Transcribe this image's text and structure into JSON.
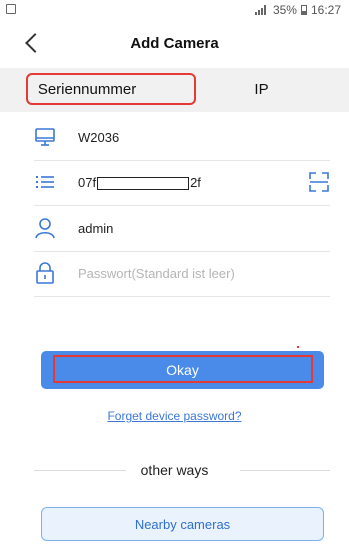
{
  "status_bar": {
    "signal_text": "",
    "battery": "35%",
    "time": "16:27"
  },
  "header": {
    "title": "Add Camera"
  },
  "tabs": [
    {
      "label": "Seriennummer"
    },
    {
      "label": "IP"
    }
  ],
  "fields": {
    "device_name": {
      "value": "W2036"
    },
    "serial": {
      "prefix": "07f",
      "suffix": "2f"
    },
    "username": {
      "value": "admin"
    },
    "password": {
      "placeholder": "Passwort(Standard ist leer)"
    }
  },
  "actions": {
    "okay_label": "Okay",
    "forget_label": "Forget device password?",
    "other_ways_label": "other ways",
    "nearby_label": "Nearby cameras"
  },
  "colors": {
    "accent": "#4a8ae8",
    "highlight": "#e53935",
    "icon": "#3c78d8"
  }
}
